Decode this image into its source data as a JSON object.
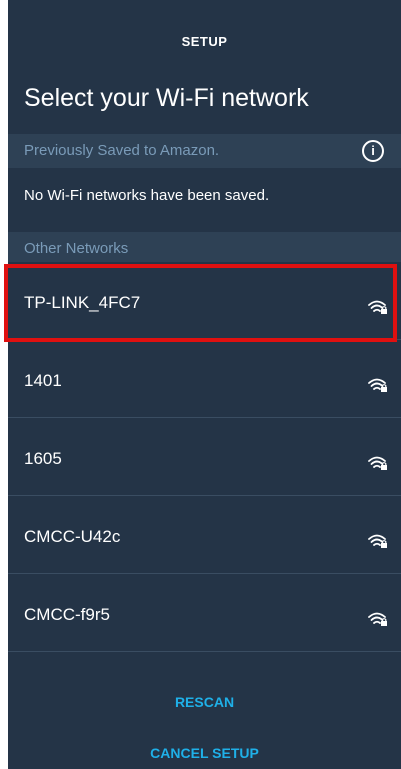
{
  "header": {
    "title": "SETUP"
  },
  "page_title": "Select your Wi-Fi network",
  "saved_section": {
    "label": "Previously Saved to Amazon.",
    "info_icon": "i",
    "empty_text": "No Wi-Fi networks have been saved."
  },
  "other_section": {
    "label": "Other Networks"
  },
  "networks": [
    {
      "name": "TP-LINK_4FC7",
      "icon": "wifi-lock-icon"
    },
    {
      "name": "1401",
      "icon": "wifi-lock-icon"
    },
    {
      "name": "1605",
      "icon": "wifi-lock-icon"
    },
    {
      "name": "CMCC-U42c",
      "icon": "wifi-lock-icon"
    },
    {
      "name": "CMCC-f9r5",
      "icon": "wifi-lock-icon"
    }
  ],
  "actions": {
    "rescan": "RESCAN",
    "cancel": "CANCEL SETUP"
  },
  "colors": {
    "background": "#243447",
    "section": "#2e4155",
    "accent": "#1fb0e8",
    "highlight": "#e01010"
  }
}
